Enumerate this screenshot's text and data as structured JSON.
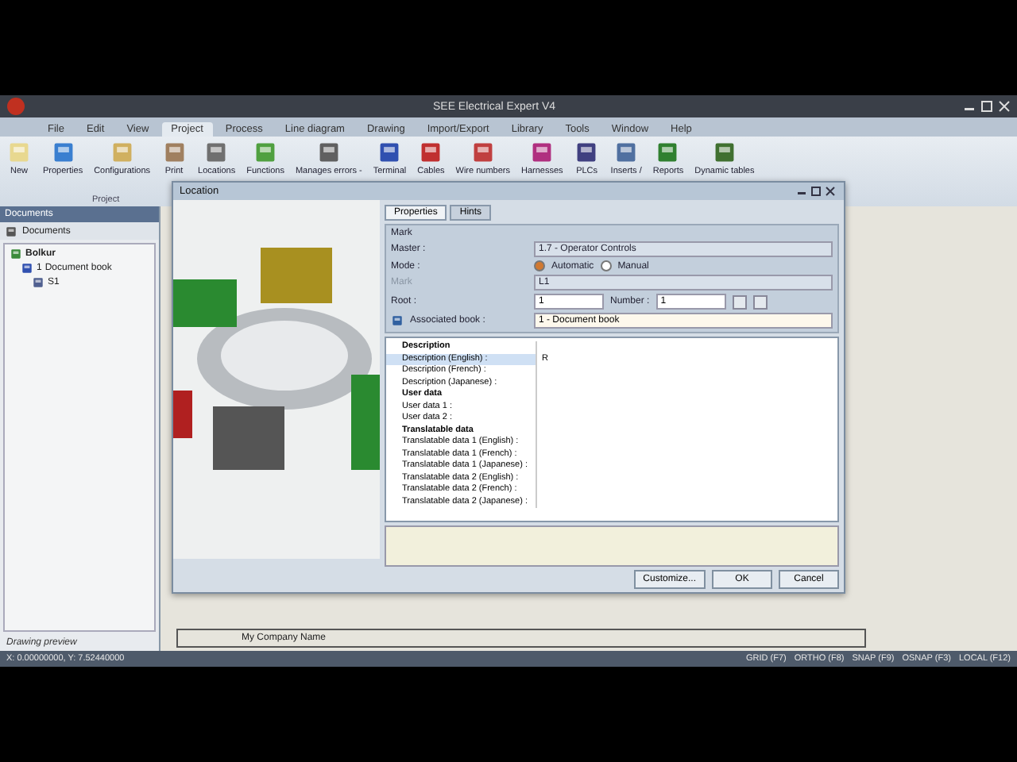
{
  "window": {
    "title": "SEE Electrical Expert V4"
  },
  "menu": [
    {
      "label": "File",
      "selected": false
    },
    {
      "label": "Edit",
      "selected": false
    },
    {
      "label": "View",
      "selected": false
    },
    {
      "label": "Project",
      "selected": true
    },
    {
      "label": "Process",
      "selected": false
    },
    {
      "label": "Line diagram",
      "selected": false
    },
    {
      "label": "Drawing",
      "selected": false
    },
    {
      "label": "Import/Export",
      "selected": false
    },
    {
      "label": "Library",
      "selected": false
    },
    {
      "label": "Tools",
      "selected": false
    },
    {
      "label": "Window",
      "selected": false
    },
    {
      "label": "Help",
      "selected": false
    }
  ],
  "ribbon": {
    "buttons": [
      {
        "label": "New"
      },
      {
        "label": "Properties"
      },
      {
        "label": "Configurations"
      },
      {
        "label": "Print"
      },
      {
        "label": "Locations"
      },
      {
        "label": "Functions"
      },
      {
        "label": "Manages errors -"
      },
      {
        "label": "Terminal"
      },
      {
        "label": "Cables"
      },
      {
        "label": "Wire numbers"
      },
      {
        "label": "Harnesses"
      },
      {
        "label": "PLCs"
      },
      {
        "label": "Inserts /"
      },
      {
        "label": "Reports"
      },
      {
        "label": "Dynamic tables"
      }
    ],
    "group": "Project"
  },
  "documents_panel": {
    "title": "Documents",
    "tab": "Documents",
    "tree": [
      {
        "label": "Bolkur",
        "children": [
          {
            "label": "1",
            "name": "Document book",
            "children": [
              {
                "label": "S1"
              }
            ]
          }
        ]
      }
    ],
    "footer": "Drawing preview"
  },
  "dialog": {
    "title": "Location",
    "tabs": [
      {
        "label": "Properties",
        "selected": true
      },
      {
        "label": "Hints",
        "selected": false
      }
    ],
    "section": "Mark",
    "master_label": "Master :",
    "master": "1.7 - Operator Controls",
    "mode_label": "Mode :",
    "modes": [
      {
        "label": "Automatic",
        "selected": true
      },
      {
        "label": "Manual",
        "selected": false
      }
    ],
    "mark_label": "Mark",
    "mark": "L1",
    "root_label": "Root :",
    "root": "1",
    "number_label": "Number :",
    "number": "1",
    "book_label": "Associated book :",
    "book": "1 - Document book",
    "rows": [
      {
        "kind": "header",
        "label": "Description",
        "selected": false
      },
      {
        "kind": "item",
        "label": "Description (English) :",
        "value": "R",
        "selected": true
      },
      {
        "kind": "item",
        "label": "Description (French) :",
        "selected": false
      },
      {
        "kind": "item",
        "label": "Description (Japanese) :",
        "selected": false
      },
      {
        "kind": "header",
        "label": "User data",
        "selected": false
      },
      {
        "kind": "item",
        "label": "User data 1 :",
        "selected": false
      },
      {
        "kind": "item",
        "label": "User data 2 :",
        "selected": false
      },
      {
        "kind": "header",
        "label": "Translatable data",
        "selected": false
      },
      {
        "kind": "item",
        "label": "Translatable data 1 (English) :",
        "selected": false
      },
      {
        "kind": "item",
        "label": "Translatable data 1 (French) :",
        "selected": false
      },
      {
        "kind": "item",
        "label": "Translatable data 1 (Japanese) :",
        "selected": false
      },
      {
        "kind": "item",
        "label": "Translatable data 2 (English) :",
        "selected": false
      },
      {
        "kind": "item",
        "label": "Translatable data 2 (French) :",
        "selected": false
      },
      {
        "kind": "item",
        "label": "Translatable data 2 (Japanese) :",
        "selected": false
      }
    ],
    "buttons": [
      "Customize...",
      "OK",
      "Cancel"
    ]
  },
  "drawing": {
    "company": "My Company Name"
  },
  "status_bar": {
    "coordinates": "X: 0.00000000, Y: 7.52440000",
    "indicators": [
      "GRID (F7)",
      "ORTHO (F8)",
      "SNAP (F9)",
      "OSNAP (F3)",
      "LOCAL (F12)"
    ]
  }
}
